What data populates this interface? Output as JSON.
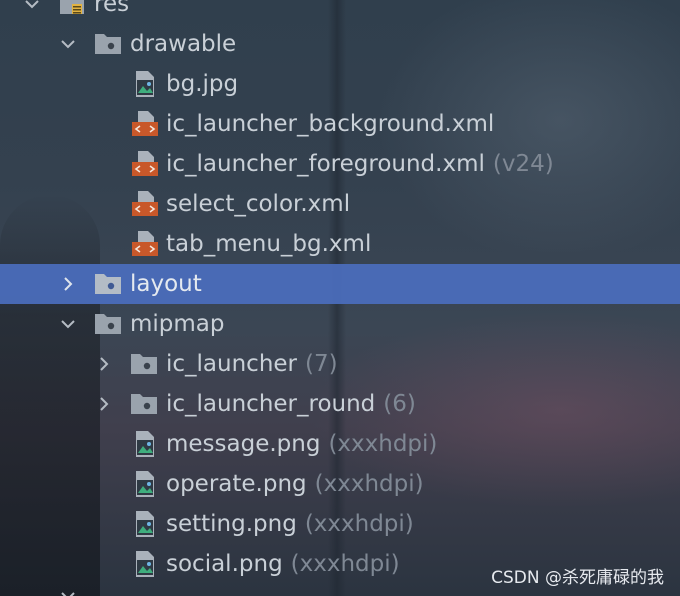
{
  "tree": {
    "root": {
      "label": "res"
    },
    "drawable": {
      "label": "drawable",
      "files": [
        {
          "name": "bg.jpg",
          "hint": "",
          "icon": "image-file-icon"
        },
        {
          "name": "ic_launcher_background.xml",
          "hint": "",
          "icon": "xml-file-icon"
        },
        {
          "name": "ic_launcher_foreground.xml",
          "hint": "(v24)",
          "icon": "xml-file-icon"
        },
        {
          "name": "select_color.xml",
          "hint": "",
          "icon": "xml-file-icon"
        },
        {
          "name": "tab_menu_bg.xml",
          "hint": "",
          "icon": "xml-file-icon"
        }
      ]
    },
    "layout": {
      "label": "layout",
      "selected": true
    },
    "mipmap": {
      "label": "mipmap",
      "folders": [
        {
          "name": "ic_launcher",
          "hint": "(7)"
        },
        {
          "name": "ic_launcher_round",
          "hint": "(6)"
        }
      ],
      "files": [
        {
          "name": "message.png",
          "hint": "(xxxhdpi)",
          "icon": "image-file-icon"
        },
        {
          "name": "operate.png",
          "hint": "(xxxhdpi)",
          "icon": "image-file-icon"
        },
        {
          "name": "setting.png",
          "hint": "(xxxhdpi)",
          "icon": "image-file-icon"
        },
        {
          "name": "social.png",
          "hint": "(xxxhdpi)",
          "icon": "image-file-icon"
        }
      ]
    }
  },
  "watermark": "CSDN @杀死庸碌的我",
  "colors": {
    "selection": "#4b6ebe",
    "text": "#c9d0d7",
    "hint": "#7f8894",
    "xml_badge": "#c8582a",
    "image_badge": "#3a8d6a"
  }
}
